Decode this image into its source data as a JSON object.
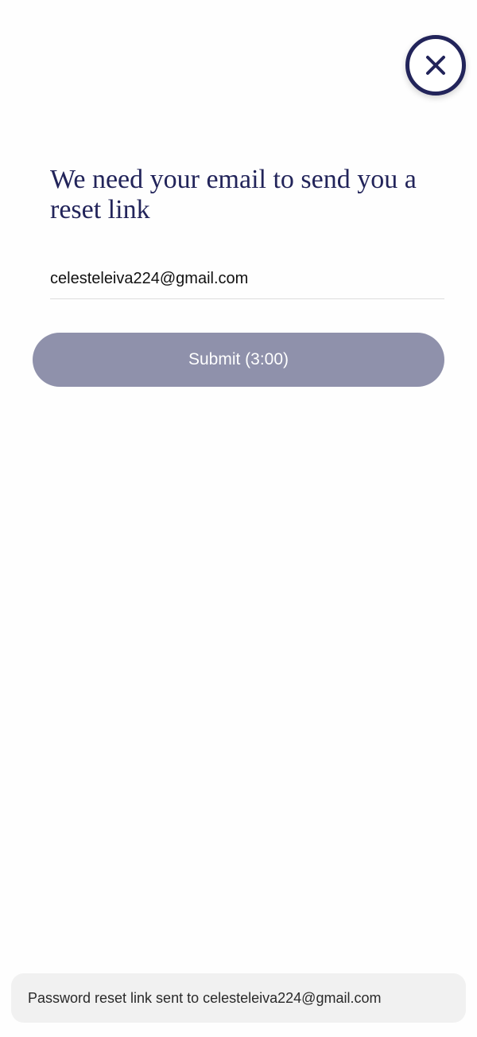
{
  "close_button": {
    "icon": "close-icon",
    "color": "#22245a"
  },
  "form": {
    "heading": "We need your email to send you a reset link",
    "email_value": "celesteleiva224@gmail.com",
    "submit_label": "Submit (3:00)",
    "submit_color": "#8f91ab"
  },
  "toast": {
    "message": "Password reset link sent to celesteleiva224@gmail.com"
  }
}
